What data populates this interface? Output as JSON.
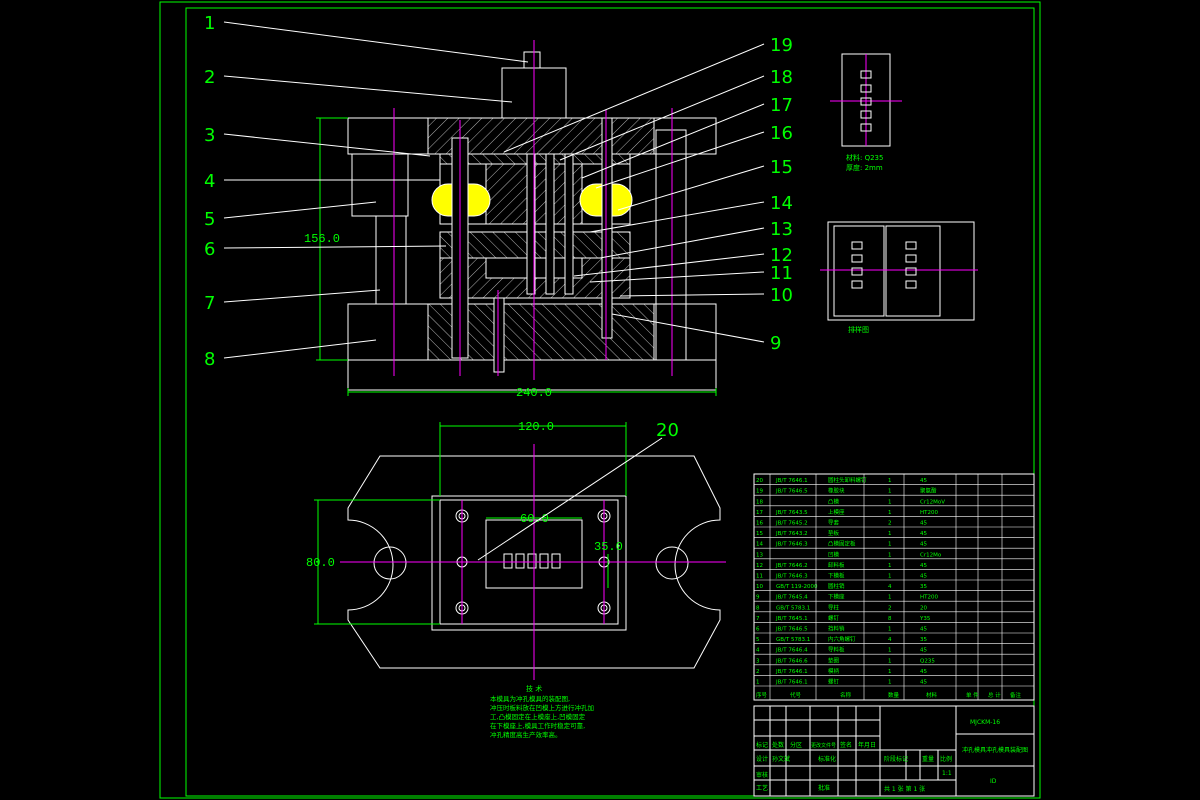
{
  "sheet": {
    "background": "#000000",
    "frame_color": "#00ff00",
    "line_color": "#ffffff",
    "centerline_color": "#ff00ff",
    "highlight_color": "#ffff00",
    "dim_color": "#00ff00"
  },
  "callouts": {
    "left": [
      "1",
      "2",
      "3",
      "4",
      "5",
      "6",
      "7",
      "8"
    ],
    "right": [
      "19",
      "18",
      "17",
      "16",
      "15",
      "14",
      "13",
      "12",
      "11",
      "10",
      "9"
    ],
    "plan": "20"
  },
  "dimensions": {
    "height": "156.0",
    "width_front": "240.0",
    "width_plan": "120.0",
    "depth_plan": "80.0",
    "inner_width": "60.0",
    "inner_depth": "35.0"
  },
  "strip_note": {
    "material": "材料: Q235",
    "thickness": "厚度: 2mm"
  },
  "layout_label": "排样图",
  "notes": {
    "title": "技 术",
    "lines": [
      "本模具为冲孔模具的装配图,",
      "冲压时板料放在凹模上方进行冲孔加",
      "工,凸模固定在上模座上,凹模固定",
      "在下模座上,模具工作时稳定可靠,",
      "冲孔精度高生产效率高。"
    ]
  },
  "bom": {
    "rows": [
      {
        "no": "20",
        "std": "JB/T 7646.1",
        "name": "圆柱头卸料螺钉",
        "qty": "1",
        "mat": "45"
      },
      {
        "no": "19",
        "std": "JB/T 7646.5",
        "name": "橡胶块",
        "qty": "1",
        "mat": "聚氨酯"
      },
      {
        "no": "18",
        "std": "",
        "name": "凸模",
        "qty": "1",
        "mat": "Cr12MoV"
      },
      {
        "no": "17",
        "std": "JB/T 7643.5",
        "name": "上模座",
        "qty": "1",
        "mat": "HT200"
      },
      {
        "no": "16",
        "std": "JB/T 7645.2",
        "name": "导套",
        "qty": "2",
        "mat": "45"
      },
      {
        "no": "15",
        "std": "JB/T 7643.2",
        "name": "垫板",
        "qty": "1",
        "mat": "45"
      },
      {
        "no": "14",
        "std": "JB/T 7646.3",
        "name": "凸模固定板",
        "qty": "1",
        "mat": "45"
      },
      {
        "no": "13",
        "std": "",
        "name": "凹模",
        "qty": "1",
        "mat": "Cr12Mo"
      },
      {
        "no": "12",
        "std": "JB/T 7646.2",
        "name": "卸料板",
        "qty": "1",
        "mat": "45"
      },
      {
        "no": "11",
        "std": "JB/T 7646.3",
        "name": "下模板",
        "qty": "1",
        "mat": "45"
      },
      {
        "no": "10",
        "std": "GB/T 119-2000",
        "name": "圆柱销",
        "qty": "4",
        "mat": "35"
      },
      {
        "no": "9",
        "std": "JB/T 7645.4",
        "name": "下模座",
        "qty": "1",
        "mat": "HT200"
      },
      {
        "no": "8",
        "std": "GB/T 5783.1",
        "name": "导柱",
        "qty": "2",
        "mat": "20"
      },
      {
        "no": "7",
        "std": "JB/T 7645.1",
        "name": "螺钉",
        "qty": "8",
        "mat": "Y35"
      },
      {
        "no": "6",
        "std": "JB/T 7646.5",
        "name": "挡料销",
        "qty": "1",
        "mat": "45"
      },
      {
        "no": "5",
        "std": "GB/T 5783.1",
        "name": "内六角螺钉",
        "qty": "4",
        "mat": "35"
      },
      {
        "no": "4",
        "std": "JB/T 7646.4",
        "name": "导料板",
        "qty": "1",
        "mat": "45"
      },
      {
        "no": "3",
        "std": "JB/T 7646.6",
        "name": "垫圈",
        "qty": "1",
        "mat": "Q235"
      },
      {
        "no": "2",
        "std": "JB/T 7646.1",
        "name": "模柄",
        "qty": "1",
        "mat": "45"
      },
      {
        "no": "1",
        "std": "JB/T 7646.1",
        "name": "螺钉",
        "qty": "1",
        "mat": "45"
      }
    ],
    "header": {
      "no": "序号",
      "std": "代号",
      "name": "名称",
      "qty": "数量",
      "mat": "材料",
      "weight_single": "单 件",
      "weight_total": "总 计",
      "remark": "备注"
    },
    "header_sub": "重 量"
  },
  "title_block": {
    "drawing_no": "MJCKM-16",
    "title": "冲孔模具冲孔模具装配图",
    "scale": "1:1",
    "sheets": "共 1 张   第 1 张",
    "stage_mark": "阶段标记",
    "weight": "重量",
    "ratio": "比例",
    "marker": "标记",
    "count": "处数",
    "zone": "分区",
    "change_no": "更改文件号",
    "sign": "签名",
    "date": "年月日",
    "designer": "设计",
    "designer_name": "孙文斌",
    "standardize": "标准化",
    "review": "审核",
    "process": "工艺",
    "approve": "批准",
    "company": "ID"
  }
}
